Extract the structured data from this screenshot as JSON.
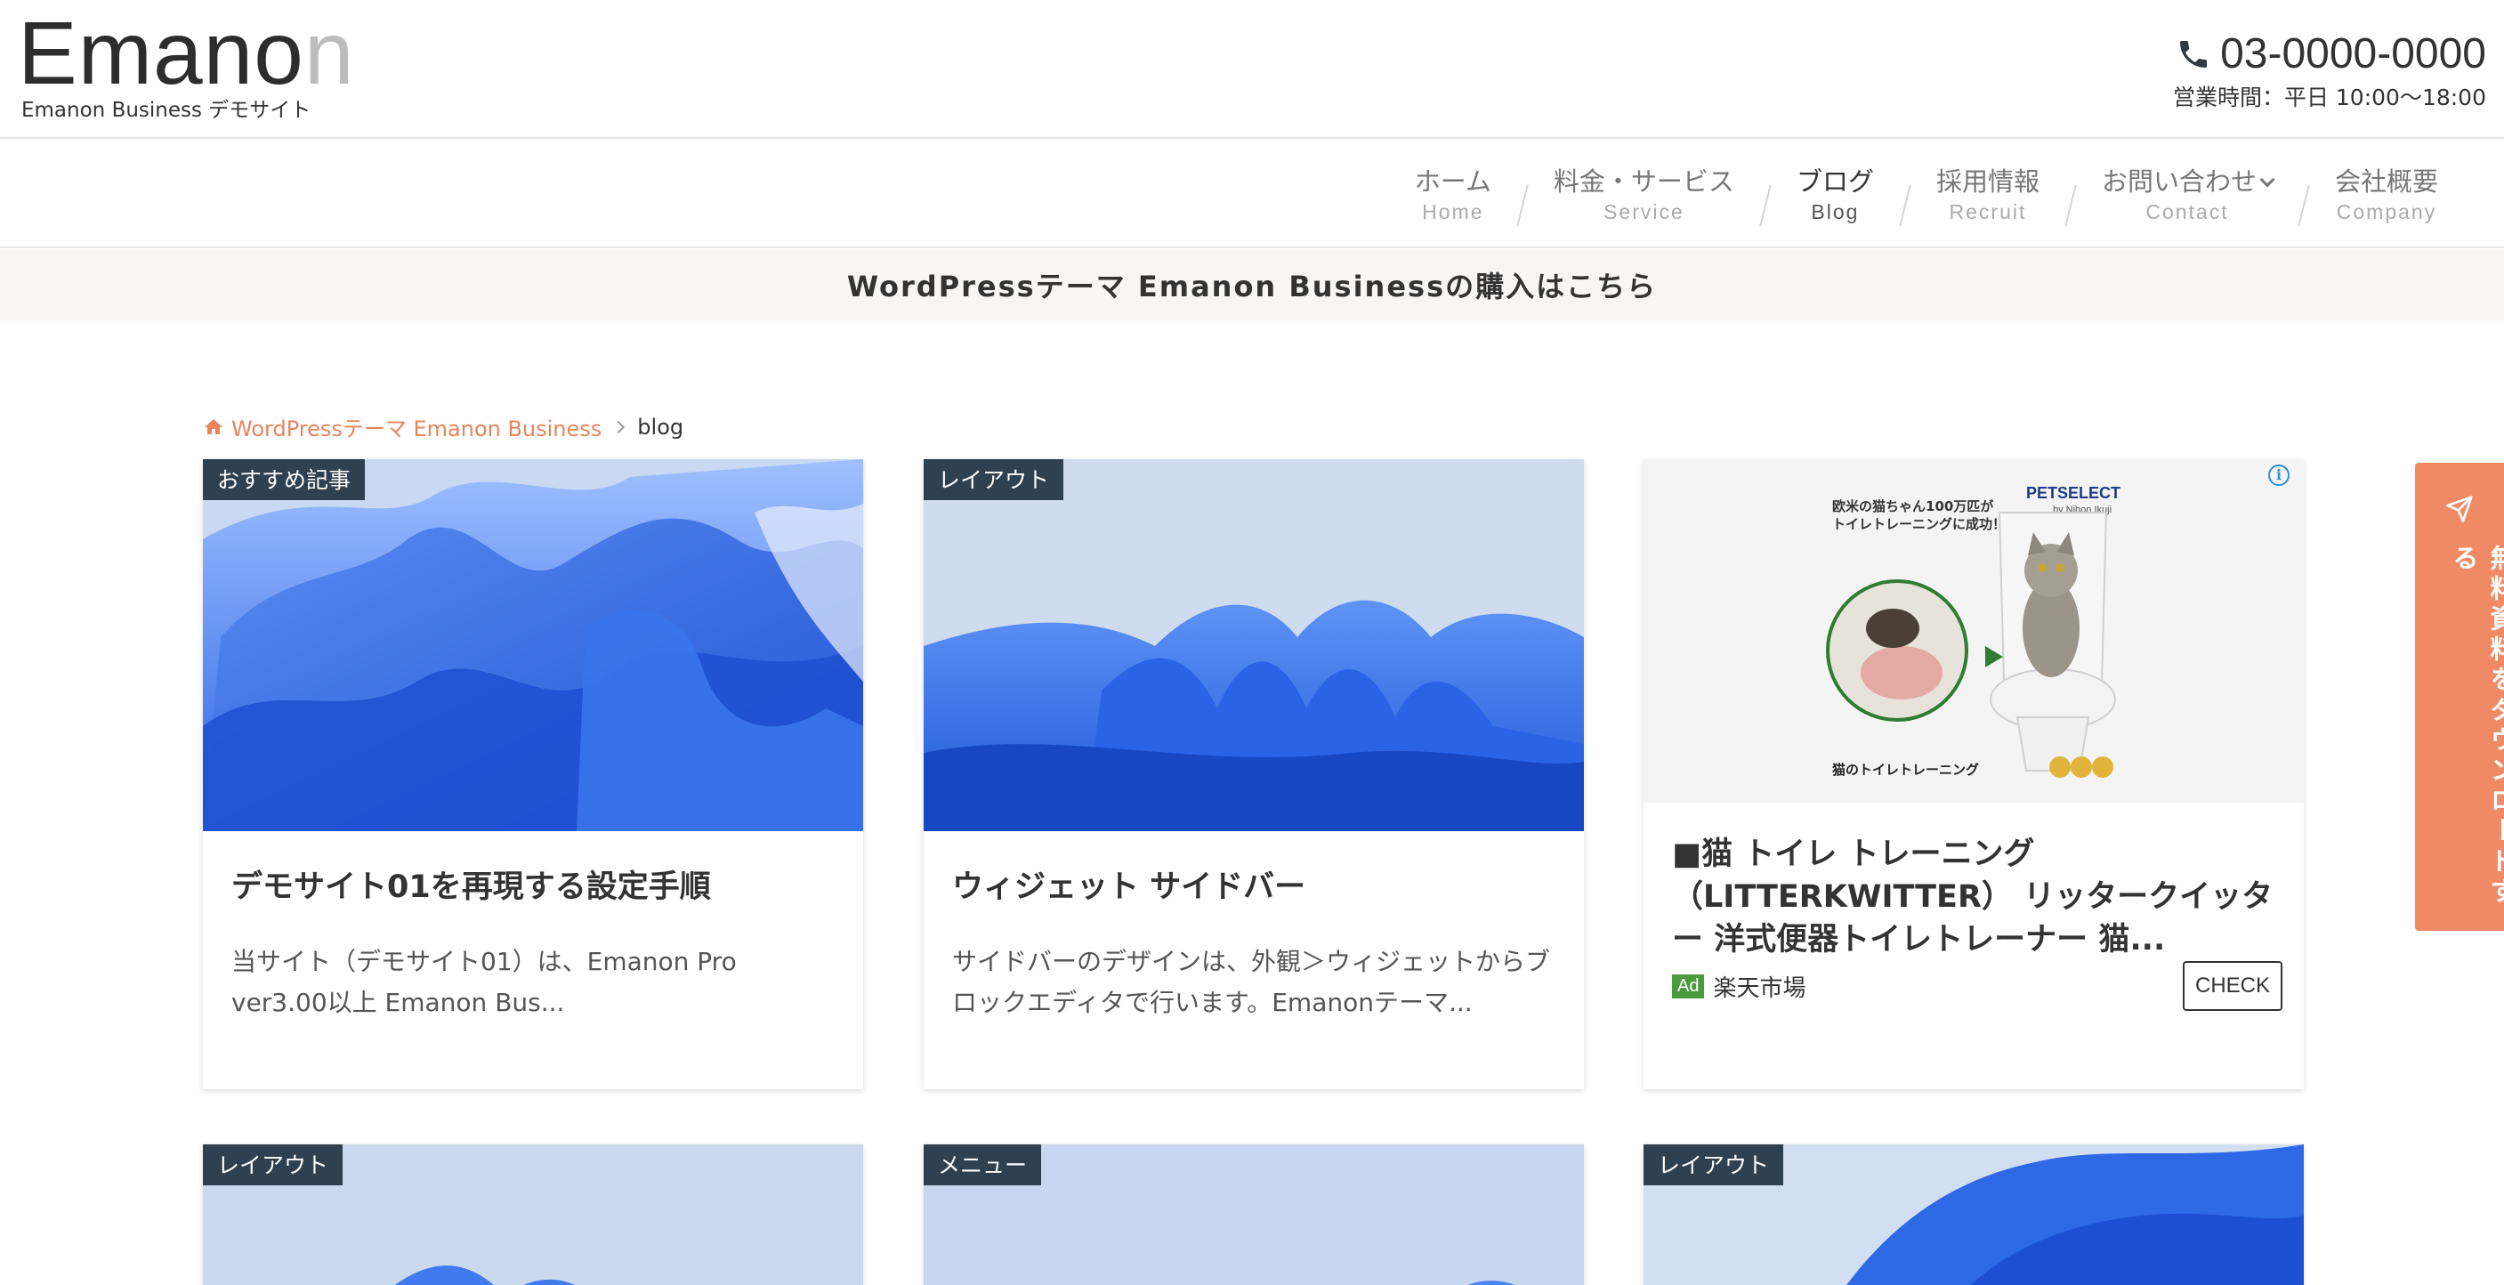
{
  "header": {
    "logo_dark": "Emano",
    "logo_light": "n",
    "logo_sub": "Emanon Business デモサイト",
    "phone": "03-0000-0000",
    "hours": "営業時間：平日 10:00〜18:00"
  },
  "nav": [
    {
      "ja": "ホーム",
      "en": "Home"
    },
    {
      "ja": "料金・サービス",
      "en": "Service"
    },
    {
      "ja": "ブログ",
      "en": "Blog"
    },
    {
      "ja": "採用情報",
      "en": "Recruit"
    },
    {
      "ja": "お問い合わせ",
      "en": "Contact"
    },
    {
      "ja": "会社概要",
      "en": "Company"
    }
  ],
  "banner": "WordPressテーマ Emanon Businessの購入はこちら",
  "breadcrumb": {
    "home": "WordPressテーマ Emanon Business",
    "current": "blog"
  },
  "cards": [
    {
      "category": "おすすめ記事",
      "title": "デモサイト01を再現する設定手順",
      "excerpt": "当サイト（デモサイト01）は、Emanon Pro ver3.00以上 Emanon Bus..."
    },
    {
      "category": "レイアウト",
      "title": "ウィジェット サイドバー",
      "excerpt": "サイドバーのデザインは、外観＞ウィジェットからブロックエディタで行います。Emanonテーマ..."
    }
  ],
  "ad": {
    "img_line1": "欧米の猫ちゃん100万匹が",
    "img_line2": "トイレトレーニングに成功！",
    "img_brand": "PETSELECT",
    "img_brand_sub": "by Nihon Ikuji",
    "img_caption": "猫のトイレトレーニング",
    "title": "■猫 トイレ トレーニング （LITTERKWITTER） リッタークイッター 洋式便器トイレトレーナー 猫...",
    "badge": "Ad",
    "shop": "楽天市場",
    "button": "CHECK"
  },
  "bottom_cards": [
    {
      "category": "レイアウト"
    },
    {
      "category": "メニュー"
    },
    {
      "category": "レイアウト"
    }
  ],
  "side_tab": "無料資料をダウンロードする",
  "colors": {
    "accent": "#ef8a65",
    "category_bg": "#2f4050",
    "banner_bg": "#f7f6f4",
    "wave_blue": "#2f6fe8"
  }
}
